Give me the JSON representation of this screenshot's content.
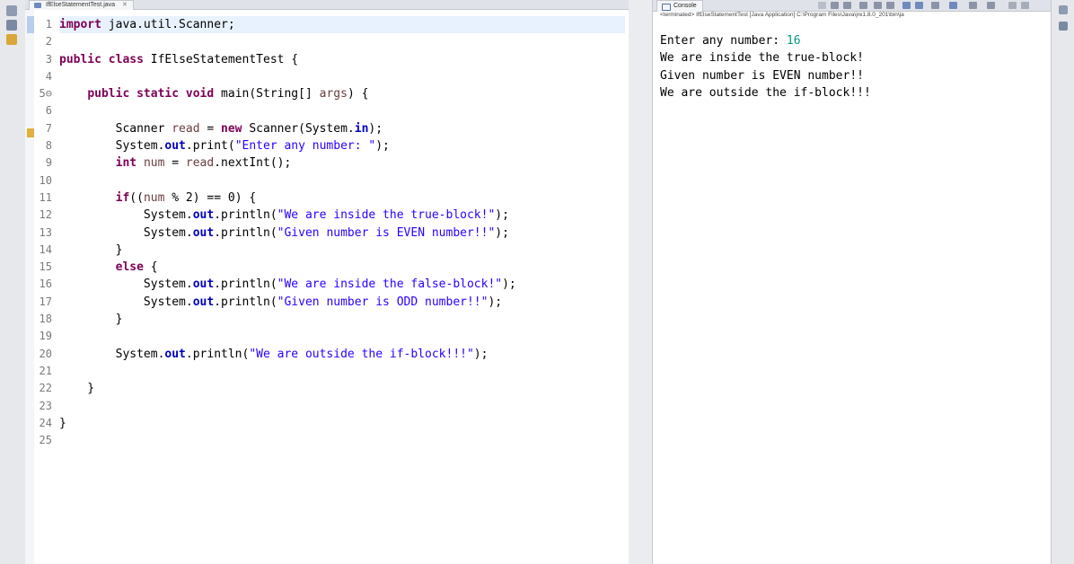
{
  "editor": {
    "tab_title": "IfElseStatementTest.java",
    "line_numbers": [
      "1",
      "2",
      "3",
      "4",
      "5⊖",
      "6",
      "7",
      "8",
      "9",
      "10",
      "11",
      "12",
      "13",
      "14",
      "15",
      "16",
      "17",
      "18",
      "19",
      "20",
      "21",
      "22",
      "23",
      "24",
      "25"
    ]
  },
  "console": {
    "tab_title": "Console",
    "status": "<terminated> IfElseStatementTest [Java Application] C:\\Program Files\\Java\\jre1.8.0_201\\bin\\ja",
    "prompt": "Enter any number: ",
    "input_value": "16",
    "output_lines": [
      "We are inside the true-block!",
      "Given number is EVEN number!!",
      "We are outside the if-block!!!"
    ]
  },
  "colors": {
    "keyword": "#7f0055",
    "string": "#2a00ff",
    "field": "#0000c0",
    "local_variable": "#6a3e3e",
    "console_input": "#009a7b"
  }
}
